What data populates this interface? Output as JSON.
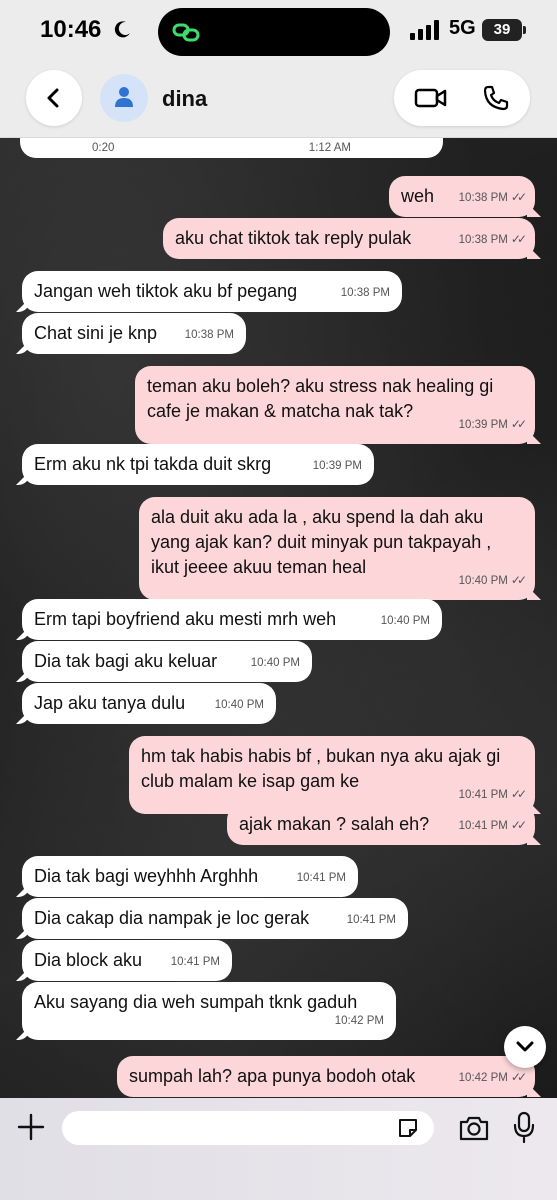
{
  "status_bar": {
    "time": "10:46",
    "network": "5G",
    "battery": "39"
  },
  "header": {
    "contact_name": "dina"
  },
  "audio_message": {
    "duration": "0:20",
    "time": "1:12 AM"
  },
  "messages": [
    {
      "direction": "out",
      "text": "weh",
      "time": "10:38 PM"
    },
    {
      "direction": "out",
      "text": "aku chat tiktok tak reply pulak",
      "time": "10:38 PM"
    },
    {
      "direction": "in",
      "text": "Jangan weh tiktok aku bf pegang",
      "time": "10:38 PM"
    },
    {
      "direction": "in",
      "text": "Chat sini je knp",
      "time": "10:38 PM"
    },
    {
      "direction": "out",
      "text": "teman aku boleh? aku stress nak healing gi cafe je makan & matcha nak tak?",
      "time": "10:39 PM"
    },
    {
      "direction": "in",
      "text": "Erm aku nk tpi takda duit skrg",
      "time": "10:39 PM"
    },
    {
      "direction": "out",
      "text": "ala duit aku ada la , aku spend la dah aku yang ajak kan? duit minyak pun takpayah , ikut jeeee akuu teman heal",
      "time": "10:40 PM"
    },
    {
      "direction": "in",
      "text": "Erm tapi boyfriend aku mesti mrh weh",
      "time": "10:40 PM"
    },
    {
      "direction": "in",
      "text": "Dia tak bagi aku keluar",
      "time": "10:40 PM"
    },
    {
      "direction": "in",
      "text": "Jap aku tanya dulu",
      "time": "10:40 PM"
    },
    {
      "direction": "out",
      "text": "hm tak habis habis bf , bukan nya aku ajak gi club malam ke isap gam ke",
      "time": "10:41 PM"
    },
    {
      "direction": "out",
      "text": "ajak makan ? salah eh?",
      "time": "10:41 PM"
    },
    {
      "direction": "in",
      "text": "Dia tak bagi weyhhh Arghhh",
      "time": "10:41 PM"
    },
    {
      "direction": "in",
      "text": "Dia cakap dia nampak je loc gerak",
      "time": "10:41 PM"
    },
    {
      "direction": "in",
      "text": "Dia block aku",
      "time": "10:41 PM"
    },
    {
      "direction": "in",
      "text": "Aku sayang dia weh sumpah tknk gaduh",
      "time": "10:42 PM"
    },
    {
      "direction": "out",
      "text": "sumpah lah? apa punya bodoh otak",
      "time": "10:42 PM"
    }
  ],
  "composer": {
    "placeholder": ""
  },
  "colors": {
    "outgoing_bubble": "#fcd6d8",
    "incoming_bubble": "#ffffff",
    "header_bg": "#ececec"
  },
  "icons": [
    "moon-icon",
    "link-icon",
    "signal-icon",
    "back-icon",
    "person-icon",
    "video-icon",
    "phone-icon",
    "chevron-down-icon",
    "plus-icon",
    "sticker-icon",
    "camera-icon",
    "mic-icon"
  ]
}
